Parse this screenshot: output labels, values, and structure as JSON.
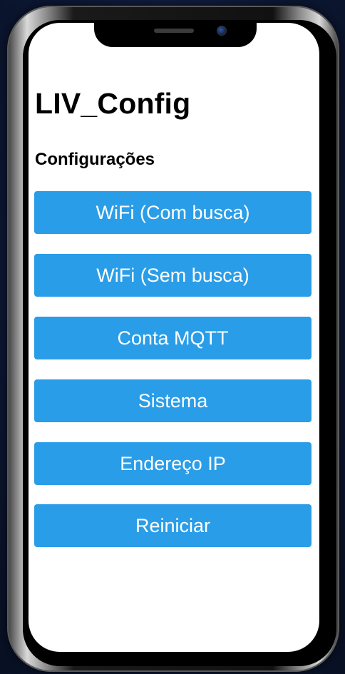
{
  "app": {
    "title": "LIV_Config",
    "section_title": "Configurações"
  },
  "menu": {
    "items": [
      {
        "label": "WiFi (Com busca)"
      },
      {
        "label": "WiFi (Sem busca)"
      },
      {
        "label": "Conta MQTT"
      },
      {
        "label": "Sistema"
      },
      {
        "label": "Endereço IP"
      },
      {
        "label": "Reiniciar"
      }
    ]
  },
  "colors": {
    "button_background": "#2a9de8",
    "button_text": "#ffffff",
    "screen_background": "#ffffff",
    "page_background": "#0f1c3d"
  },
  "icons": {
    "camera": "front-camera-icon",
    "speaker": "earpiece-speaker-icon"
  }
}
